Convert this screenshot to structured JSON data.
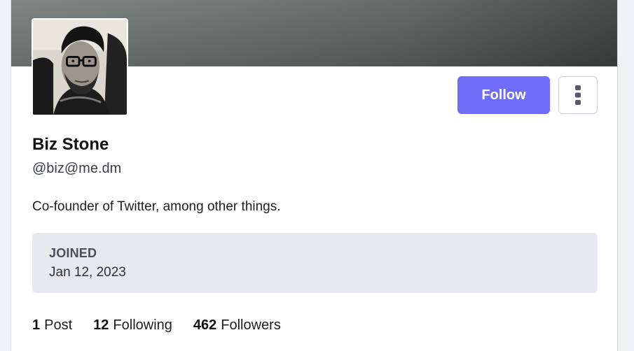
{
  "profile": {
    "display_name": "Biz Stone",
    "handle": "@biz@me.dm",
    "bio": "Co-founder of Twitter, among other things.",
    "joined_label": "JOINED",
    "joined_date": "Jan 12, 2023"
  },
  "actions": {
    "follow_label": "Follow",
    "more_icon": "vertical-ellipsis-icon"
  },
  "stats": {
    "posts_count": "1",
    "posts_label": "Post",
    "following_count": "12",
    "following_label": "Following",
    "followers_count": "462",
    "followers_label": "Followers"
  },
  "colors": {
    "accent": "#6e6cf9",
    "joined_bg": "#e7e9ee",
    "page_bg": "#eff3f6"
  }
}
